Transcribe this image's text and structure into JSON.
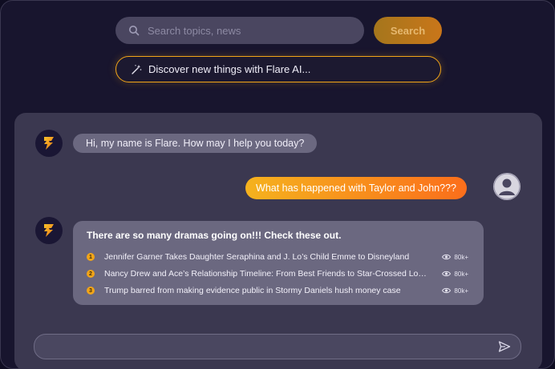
{
  "search": {
    "placeholder": "Search topics, news",
    "button_label": "Search"
  },
  "discover": {
    "text": "Discover new things with Flare AI..."
  },
  "chat": {
    "greeting": "Hi, my name is Flare. How may I help you today?",
    "user_message": "What has happened with Taylor and John???",
    "reply_title": "There are so many dramas going on!!! Check these out.",
    "news": [
      {
        "num": "1",
        "title": "Jennifer Garner Takes Daughter Seraphina and J. Lo’s Child Emme to Disneyland",
        "views": "80k+"
      },
      {
        "num": "2",
        "title": "Nancy Drew and Ace’s Relationship Timeline: From Best Friends to Star-Crossed Lovers...",
        "views": "80k+"
      },
      {
        "num": "3",
        "title": "Trump barred from making evidence public in Stormy Daniels hush money case",
        "views": "80k+"
      }
    ]
  },
  "colors": {
    "accent": "#f2a518",
    "user_bubble_start": "#f5b21e",
    "user_bubble_end": "#fb6e1b"
  },
  "icons": [
    "search-icon",
    "magic-wand-icon",
    "flare-logo-icon",
    "user-avatar-icon",
    "eye-icon",
    "send-icon"
  ]
}
